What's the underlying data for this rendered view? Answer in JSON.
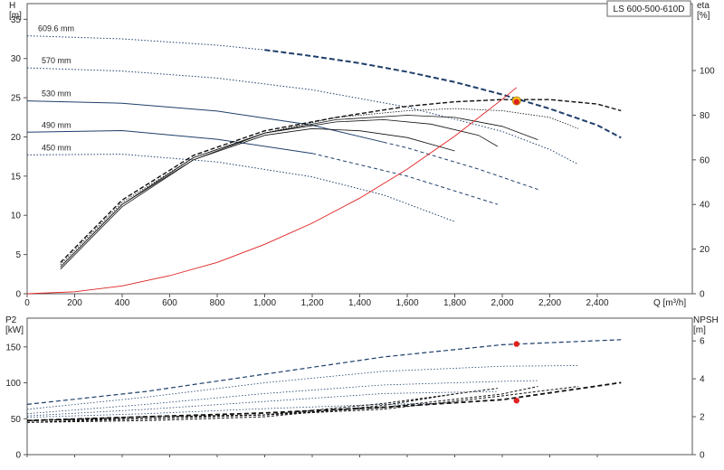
{
  "model": "LS 600-500-610D",
  "colors": {
    "pump_curve": "#1f3f6b",
    "efficiency": "#111111",
    "system_curve": "#e02020",
    "marker_fill": "#ffd21a",
    "marker_red": "#e02020",
    "grid": "#cfcfcf"
  },
  "chart_data": [
    {
      "type": "line",
      "panel": "head-efficiency",
      "xlabel": "Q [m³/h]",
      "ylabel": "H\n[m]",
      "y2label": "eta\n[%]",
      "xlim": [
        0,
        2800
      ],
      "ylim": [
        0,
        37
      ],
      "y2lim": [
        0,
        130
      ],
      "x_ticks": [
        "0",
        "200",
        "400",
        "600",
        "800",
        "1,000",
        "1,200",
        "1,400",
        "1,600",
        "1,800",
        "2,000",
        "2,200",
        "2,400"
      ],
      "y_ticks": [
        "0",
        "5",
        "10",
        "15",
        "20",
        "25",
        "30",
        "35"
      ],
      "y2_ticks": [
        "0",
        "20",
        "40",
        "60",
        "80",
        "100"
      ],
      "grid": false,
      "head_curves": [
        {
          "name": "609.6 mm",
          "x": [
            0,
            400,
            800,
            1000,
            1200,
            1400,
            1600,
            1800,
            2000,
            2200,
            2400,
            2500
          ],
          "y": [
            32.9,
            32.5,
            31.7,
            31.1,
            30.3,
            29.4,
            28.3,
            27.0,
            25.4,
            23.6,
            21.5,
            19.9
          ],
          "op_start": 1000
        },
        {
          "name": "570 mm",
          "x": [
            0,
            400,
            800,
            1200,
            1600,
            2000,
            2200,
            2320
          ],
          "y": [
            28.8,
            28.4,
            27.5,
            26.0,
            23.8,
            20.7,
            18.4,
            16.5
          ],
          "op_start": 2330
        },
        {
          "name": "530 mm",
          "x": [
            0,
            400,
            800,
            1200,
            1600,
            1900,
            2150
          ],
          "y": [
            24.6,
            24.3,
            23.3,
            21.5,
            18.6,
            15.9,
            13.3
          ],
          "op_start": 1500
        },
        {
          "name": "490 mm",
          "x": [
            0,
            400,
            800,
            1200,
            1600,
            1800,
            1980
          ],
          "y": [
            20.6,
            20.8,
            19.7,
            17.9,
            15.0,
            13.1,
            11.4
          ],
          "op_start": 1200
        },
        {
          "name": "450 mm",
          "x": [
            0,
            400,
            800,
            1200,
            1500,
            1800
          ],
          "y": [
            17.7,
            17.8,
            16.8,
            14.9,
            12.6,
            9.2
          ],
          "op_start": 1900
        }
      ],
      "efficiency_curves": [
        {
          "x": [
            140,
            400,
            700,
            1000,
            1300,
            1600,
            1800,
            2000,
            2200,
            2400,
            2500
          ],
          "y": [
            14,
            42,
            62,
            73,
            79,
            84,
            86,
            87,
            87,
            85,
            82
          ]
        },
        {
          "x": [
            140,
            400,
            700,
            1000,
            1300,
            1600,
            1800,
            2000,
            2200,
            2320
          ],
          "y": [
            13,
            41,
            61,
            72,
            79,
            82,
            83,
            82,
            79,
            74
          ]
        },
        {
          "x": [
            140,
            400,
            700,
            1000,
            1300,
            1600,
            1800,
            2000,
            2150
          ],
          "y": [
            12,
            40,
            60,
            72,
            78,
            80,
            79,
            75,
            69
          ]
        },
        {
          "x": [
            140,
            400,
            700,
            1000,
            1300,
            1500,
            1700,
            1900,
            1980
          ],
          "y": [
            12,
            40,
            61,
            72,
            77,
            78,
            76,
            71,
            66
          ]
        },
        {
          "x": [
            140,
            400,
            700,
            1000,
            1200,
            1400,
            1600,
            1800
          ],
          "y": [
            11,
            39,
            60,
            71,
            74,
            73,
            70,
            64
          ]
        }
      ],
      "system_curve": {
        "x": [
          0,
          200,
          400,
          600,
          800,
          1000,
          1200,
          1400,
          1600,
          1800,
          2000,
          2060
        ],
        "y": [
          0,
          0.25,
          1.0,
          2.3,
          4.0,
          6.3,
          9.0,
          12.2,
          15.9,
          20.1,
          24.8,
          26.3
        ]
      },
      "duty_point": {
        "x": 2060,
        "y": 24.6,
        "eta": 86
      }
    },
    {
      "type": "line",
      "panel": "power-npsh",
      "ylabel": "P2\n[kW]",
      "y2label": "NPSH\n[m]",
      "xlim": [
        0,
        2800
      ],
      "ylim": [
        0,
        190
      ],
      "y2lim": [
        0,
        7.2
      ],
      "y_ticks": [
        "0",
        "50",
        "100",
        "150"
      ],
      "y2_ticks": [
        "0",
        "2",
        "4",
        "6"
      ],
      "power_curves": [
        {
          "x": [
            0,
            500,
            1000,
            1500,
            2000,
            2500
          ],
          "y": [
            70,
            88,
            112,
            136,
            153,
            160
          ]
        },
        {
          "x": [
            0,
            500,
            1000,
            1500,
            2000,
            2320
          ],
          "y": [
            63,
            80,
            100,
            116,
            123,
            124
          ]
        },
        {
          "x": [
            0,
            500,
            1000,
            1500,
            2000,
            2150
          ],
          "y": [
            57,
            70,
            85,
            97,
            102,
            103
          ]
        },
        {
          "x": [
            0,
            500,
            1000,
            1500,
            1980
          ],
          "y": [
            54,
            63,
            74,
            85,
            88
          ]
        },
        {
          "x": [
            0,
            500,
            1000,
            1500,
            1800
          ],
          "y": [
            52,
            57,
            64,
            70,
            72
          ]
        }
      ],
      "npsh_curves": [
        {
          "x": [
            0,
            500,
            1000,
            1500,
            2000,
            2500
          ],
          "y": [
            1.8,
            2.0,
            2.2,
            2.5,
            2.9,
            3.8
          ]
        },
        {
          "x": [
            0,
            500,
            1000,
            1500,
            2000,
            2320
          ],
          "y": [
            1.8,
            2.0,
            2.1,
            2.4,
            3.1,
            3.6
          ]
        },
        {
          "x": [
            0,
            500,
            1000,
            1500,
            2000,
            2150
          ],
          "y": [
            1.8,
            1.9,
            2.1,
            2.5,
            3.2,
            3.6
          ]
        },
        {
          "x": [
            0,
            500,
            1000,
            1500,
            1980
          ],
          "y": [
            1.7,
            1.9,
            2.1,
            2.7,
            3.5
          ]
        },
        {
          "x": [
            0,
            500,
            1000,
            1500,
            1800
          ],
          "y": [
            1.7,
            1.8,
            2.0,
            2.6,
            3.2
          ]
        }
      ],
      "duty_point": {
        "x": 2060,
        "p2": 154,
        "npsh": 2.85
      }
    }
  ]
}
